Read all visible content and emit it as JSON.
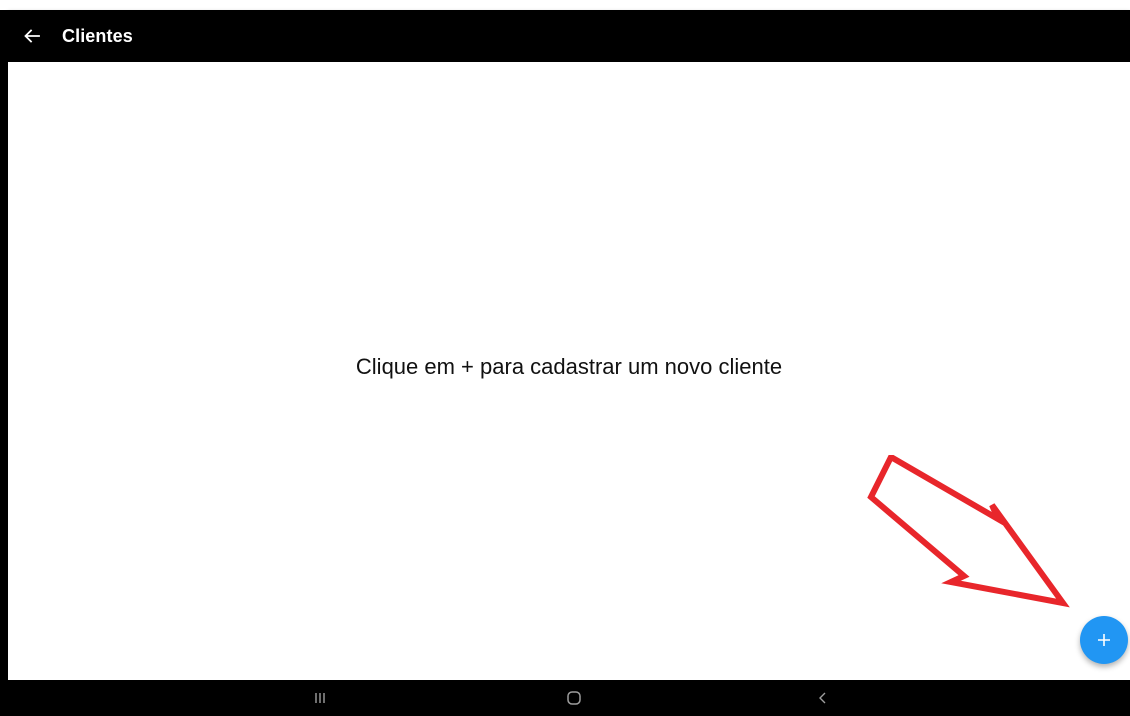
{
  "appbar": {
    "title": "Clientes",
    "back_icon": "arrow-left-icon"
  },
  "main": {
    "empty_message": "Clique em + para cadastrar um novo cliente"
  },
  "fab": {
    "icon": "plus-icon",
    "color": "#2196f3"
  },
  "annotation": {
    "icon": "red-arrow-outline",
    "color": "#e8262b"
  },
  "system_nav": {
    "recents_icon": "recents-icon",
    "home_icon": "home-icon",
    "back_icon": "chevron-left-icon"
  },
  "colors": {
    "appbar_bg": "#000000",
    "content_bg": "#ffffff",
    "accent": "#2196f3"
  }
}
